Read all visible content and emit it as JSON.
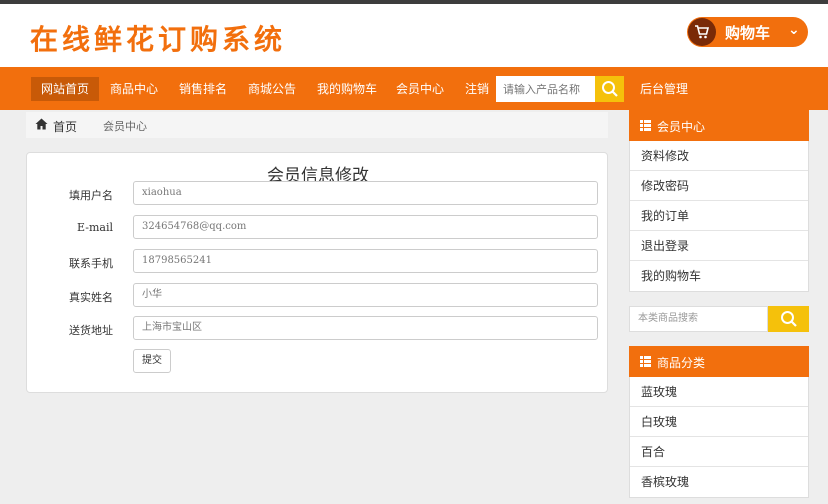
{
  "header": {
    "logo_text": "在线鲜花订购系统",
    "cart_label": "购物车",
    "cart_chevron": "⌄"
  },
  "nav": {
    "items": [
      "网站首页",
      "商品中心",
      "销售排名",
      "商城公告",
      "我的购物车",
      "会员中心",
      "注销"
    ],
    "search_placeholder": "请输入产品名称",
    "admin_label": "后台管理"
  },
  "breadcrumb": {
    "home": "首页",
    "separator": "/",
    "current": "会员中心"
  },
  "form": {
    "title": "会员信息修改",
    "fields": [
      {
        "label": "填用户名",
        "value": "xiaohua"
      },
      {
        "label": "E-mail",
        "value": "324654768@qq.com"
      },
      {
        "label": "联系手机",
        "value": "18798565241"
      },
      {
        "label": "真实姓名",
        "value": "小华"
      },
      {
        "label": "送货地址",
        "value": "上海市宝山区"
      }
    ],
    "submit_label": "提交"
  },
  "sidebar": {
    "member_title": "会员中心",
    "member_items": [
      "资料修改",
      "修改密码",
      "我的订单",
      "退出登录",
      "我的购物车"
    ],
    "search_placeholder": "本类商品搜索",
    "category_title": "商品分类",
    "category_items": [
      "蓝玫瑰",
      "白玫瑰",
      "百合",
      "香槟玫瑰"
    ]
  },
  "colors": {
    "brand_orange": "#f26f0d",
    "search_yellow": "#f5c10b",
    "cart_dark": "#7a2a07"
  },
  "icons": [
    "cart-icon",
    "chevron-down-icon",
    "search-icon",
    "home-icon",
    "list-icon"
  ]
}
